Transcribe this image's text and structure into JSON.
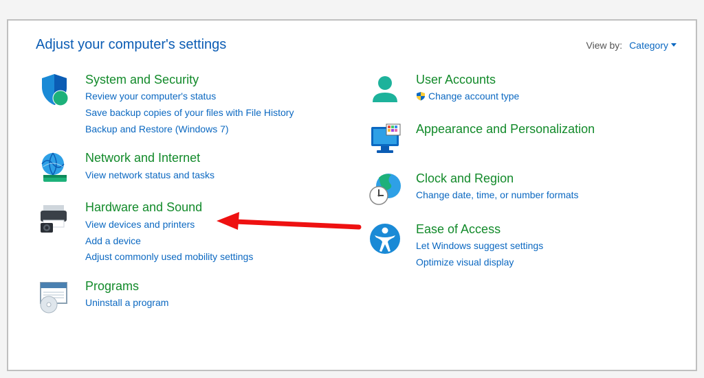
{
  "header": {
    "title": "Adjust your computer's settings",
    "viewby_label": "View by:",
    "viewby_value": "Category"
  },
  "left": [
    {
      "icon": "shield-security-icon",
      "title": "System and Security",
      "links": [
        {
          "text": "Review your computer's status"
        },
        {
          "text": "Save backup copies of your files with File History"
        },
        {
          "text": "Backup and Restore (Windows 7)"
        }
      ]
    },
    {
      "icon": "globe-network-icon",
      "title": "Network and Internet",
      "links": [
        {
          "text": "View network status and tasks"
        }
      ]
    },
    {
      "icon": "printer-hardware-icon",
      "title": "Hardware and Sound",
      "links": [
        {
          "text": "View devices and printers"
        },
        {
          "text": "Add a device"
        },
        {
          "text": "Adjust commonly used mobility settings"
        }
      ]
    },
    {
      "icon": "programs-disc-icon",
      "title": "Programs",
      "links": [
        {
          "text": "Uninstall a program"
        }
      ]
    }
  ],
  "right": [
    {
      "icon": "user-accounts-icon",
      "title": "User Accounts",
      "links": [
        {
          "text": "Change account type",
          "shield": true
        }
      ]
    },
    {
      "icon": "personalization-monitor-icon",
      "title": "Appearance and Personalization",
      "links": []
    },
    {
      "icon": "clock-region-icon",
      "title": "Clock and Region",
      "links": [
        {
          "text": "Change date, time, or number formats"
        }
      ]
    },
    {
      "icon": "ease-of-access-icon",
      "title": "Ease of Access",
      "links": [
        {
          "text": "Let Windows suggest settings"
        },
        {
          "text": "Optimize visual display"
        }
      ]
    }
  ]
}
